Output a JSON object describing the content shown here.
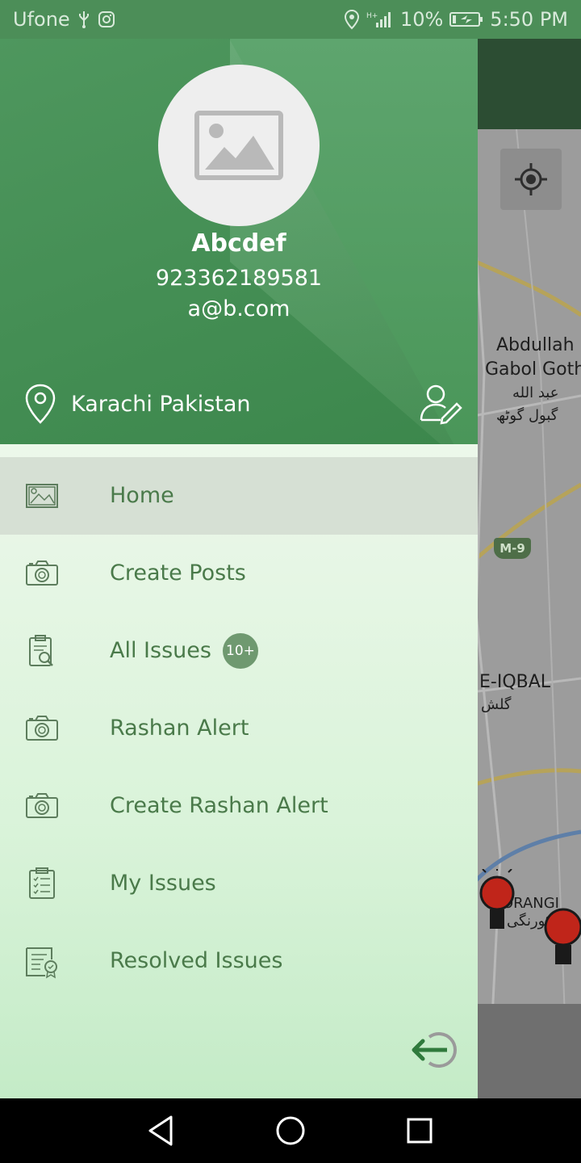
{
  "status_bar": {
    "carrier": "Ufone",
    "battery_percent": "10%",
    "time": "5:50 PM",
    "icons": [
      "usb-icon",
      "instagram-icon",
      "location-icon",
      "signal-icon",
      "battery-charging-icon"
    ]
  },
  "profile": {
    "name": "Abcdef",
    "phone": "923362189581",
    "email": "a@b.com",
    "location": "Karachi  Pakistan",
    "avatar_icon": "image-placeholder-icon"
  },
  "menu": {
    "items": [
      {
        "label": "Home",
        "icon": "home-gallery-icon",
        "active": true
      },
      {
        "label": "Create Posts",
        "icon": "camera-icon"
      },
      {
        "label": "All Issues",
        "icon": "search-document-icon",
        "badge": "10+"
      },
      {
        "label": "Rashan Alert",
        "icon": "camera-icon"
      },
      {
        "label": "Create Rashan Alert",
        "icon": "camera-icon"
      },
      {
        "label": "My Issues",
        "icon": "checklist-icon"
      },
      {
        "label": "Resolved Issues",
        "icon": "certificate-icon"
      }
    ]
  },
  "map": {
    "labels": {
      "abdullah_1": "Abdullah",
      "abdullah_2": "Gabol Goth",
      "urdu_1": "عبد الله",
      "urdu_2": "گبول گوٹھ",
      "highway": "M-9",
      "iqbal": "E-IQBAL",
      "iqbal_urdu": "گلش",
      "orangi": "ORANGI",
      "orangi_urdu": "کورنگی"
    }
  },
  "colors": {
    "header_green": "#3f8e50",
    "menu_text": "#4a7a4a",
    "badge": "#6f9970",
    "status_bar": "#4c8e58"
  }
}
